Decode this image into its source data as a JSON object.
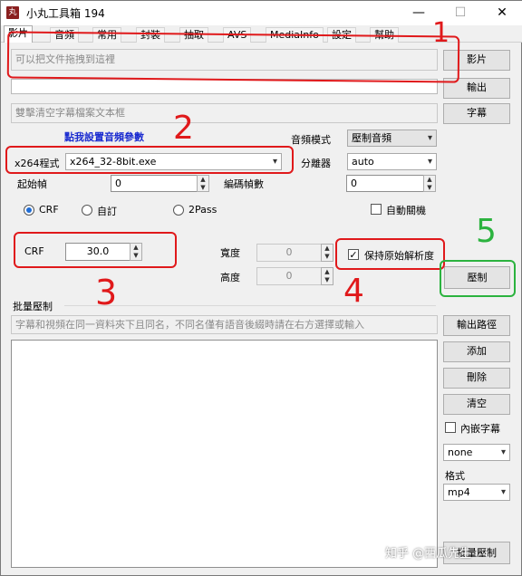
{
  "window": {
    "title": "小丸工具箱 194",
    "icon_text": "丸"
  },
  "window_controls": {
    "minimize": "—",
    "maximize": "☐",
    "close": "✕"
  },
  "tabs": [
    "影片",
    "音頻",
    "常用",
    "封裝",
    "抽取",
    "AVS",
    "MediaInfo",
    "設定",
    "幫助"
  ],
  "drop_field": {
    "placeholder": "可以把文件拖拽到這裡"
  },
  "output_field": {
    "value": ""
  },
  "subtitle_field": {
    "placeholder": "雙擊清空字幕檔案文本框"
  },
  "buttons": {
    "video": "影片",
    "output": "輸出",
    "subtitle": "字幕",
    "encode": "壓制"
  },
  "audio_link": "點我設置音頻參數",
  "audio_mode": {
    "label": "音頻模式",
    "value": "壓制音頻"
  },
  "x264": {
    "label": "x264程式",
    "value": "x264_32-8bit.exe"
  },
  "splitter": {
    "label": "分離器",
    "value": "auto"
  },
  "start_frame": {
    "label": "起始幀",
    "value": "0"
  },
  "encode_frames": {
    "label": "編碼幀數",
    "value": "0"
  },
  "rate_modes": {
    "crf": "CRF",
    "custom": "自訂",
    "twopass": "2Pass",
    "selected": "crf"
  },
  "auto_shutdown": "自動關機",
  "crf": {
    "label": "CRF",
    "value": "30.0"
  },
  "width": {
    "label": "寬度",
    "value": "0"
  },
  "height": {
    "label": "高度",
    "value": "0"
  },
  "keep_resolution": {
    "label": "保持原始解析度",
    "checked": true
  },
  "batch": {
    "title": "批量壓制",
    "hint": "字幕和視頻在同一資料夾下且同名，不同名僅有語音後綴時請在右方選擇或輸入",
    "buttons": {
      "output_path": "輸出路徑",
      "add": "添加",
      "delete": "刪除",
      "clear": "清空"
    },
    "embed_subtitle": "內嵌字幕",
    "suffix_select": "none",
    "format_label": "格式",
    "format_select": "mp4",
    "batch_encode": "批量壓制"
  },
  "annotations": [
    "1",
    "2",
    "3",
    "4",
    "5"
  ],
  "watermark": "知乎 @西瓜先生",
  "colors": {
    "annotation_red": "#e0191b",
    "annotation_green": "#2cb33f",
    "link_blue": "#1a2bd0"
  }
}
